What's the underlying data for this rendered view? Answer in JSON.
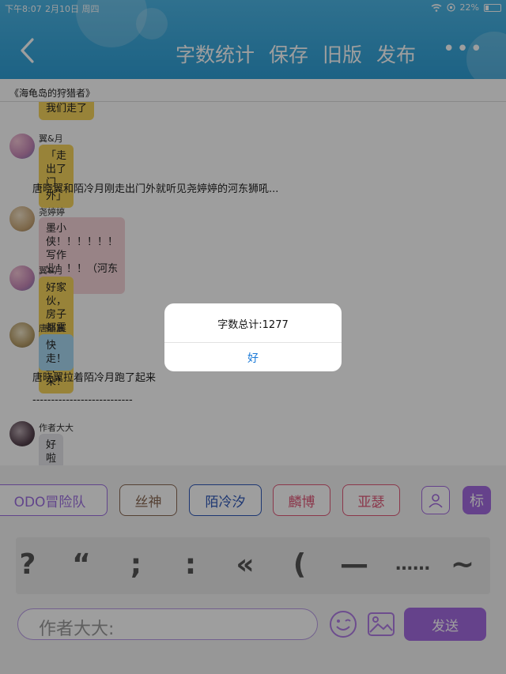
{
  "status_bar": {
    "time": "下午8:07",
    "date": "2月10日 周四",
    "battery": "22%"
  },
  "header": {
    "actions": [
      "字数统计",
      "保存",
      "旧版",
      "发布"
    ],
    "more": "•••"
  },
  "book_title": "《海龟岛的狩猎者》",
  "chat": {
    "top_cut_bubble": "我们走了",
    "messages": [
      {
        "name": "翼&月",
        "text": "「走出了门外」",
        "bubble_color": "#f5d35c"
      },
      {
        "narration": "唐晓翼和陌冷月刚走出门外就听见尧婷婷的河东狮吼..."
      },
      {
        "name": "尧婷婷",
        "text_lines": [
          "墨小侠！！！！！！写作",
          "业！！！（河东狮吼）"
        ],
        "bubble_color": "#f6d4d8"
      },
      {
        "name": "翼&月",
        "text_lines": [
          "好家伙，房子都震了，我的耳",
          "朵！"
        ],
        "bubble_color": "#f5d35c"
      },
      {
        "name": "唐晓翼",
        "text": "快走！",
        "bubble_color": "#a9d9f3"
      },
      {
        "narration": "唐晓翼拉着陌冷月跑了起来"
      },
      {
        "narration": "---------------------------"
      },
      {
        "name": "作者大大",
        "text": "好啦",
        "bubble_color": "#e6e6ea"
      }
    ]
  },
  "tags": [
    {
      "label": "ODO冒险队",
      "color": "#9d6fe0"
    },
    {
      "label": "丝神",
      "color": "#8a6a54"
    },
    {
      "label": "陌冷汐",
      "color": "#2e58b8"
    },
    {
      "label": "麟博",
      "color": "#e05a7a"
    },
    {
      "label": "亚瑟",
      "color": "#e05a7a"
    }
  ],
  "tag_icon_label": "标",
  "punctuation": [
    "?",
    "“",
    ";",
    ":",
    "«",
    "(",
    "—",
    "……",
    "~"
  ],
  "input": {
    "placeholder": "作者大大:"
  },
  "send_label": "发送",
  "alert": {
    "message": "字数总计:1277",
    "button": "好"
  }
}
